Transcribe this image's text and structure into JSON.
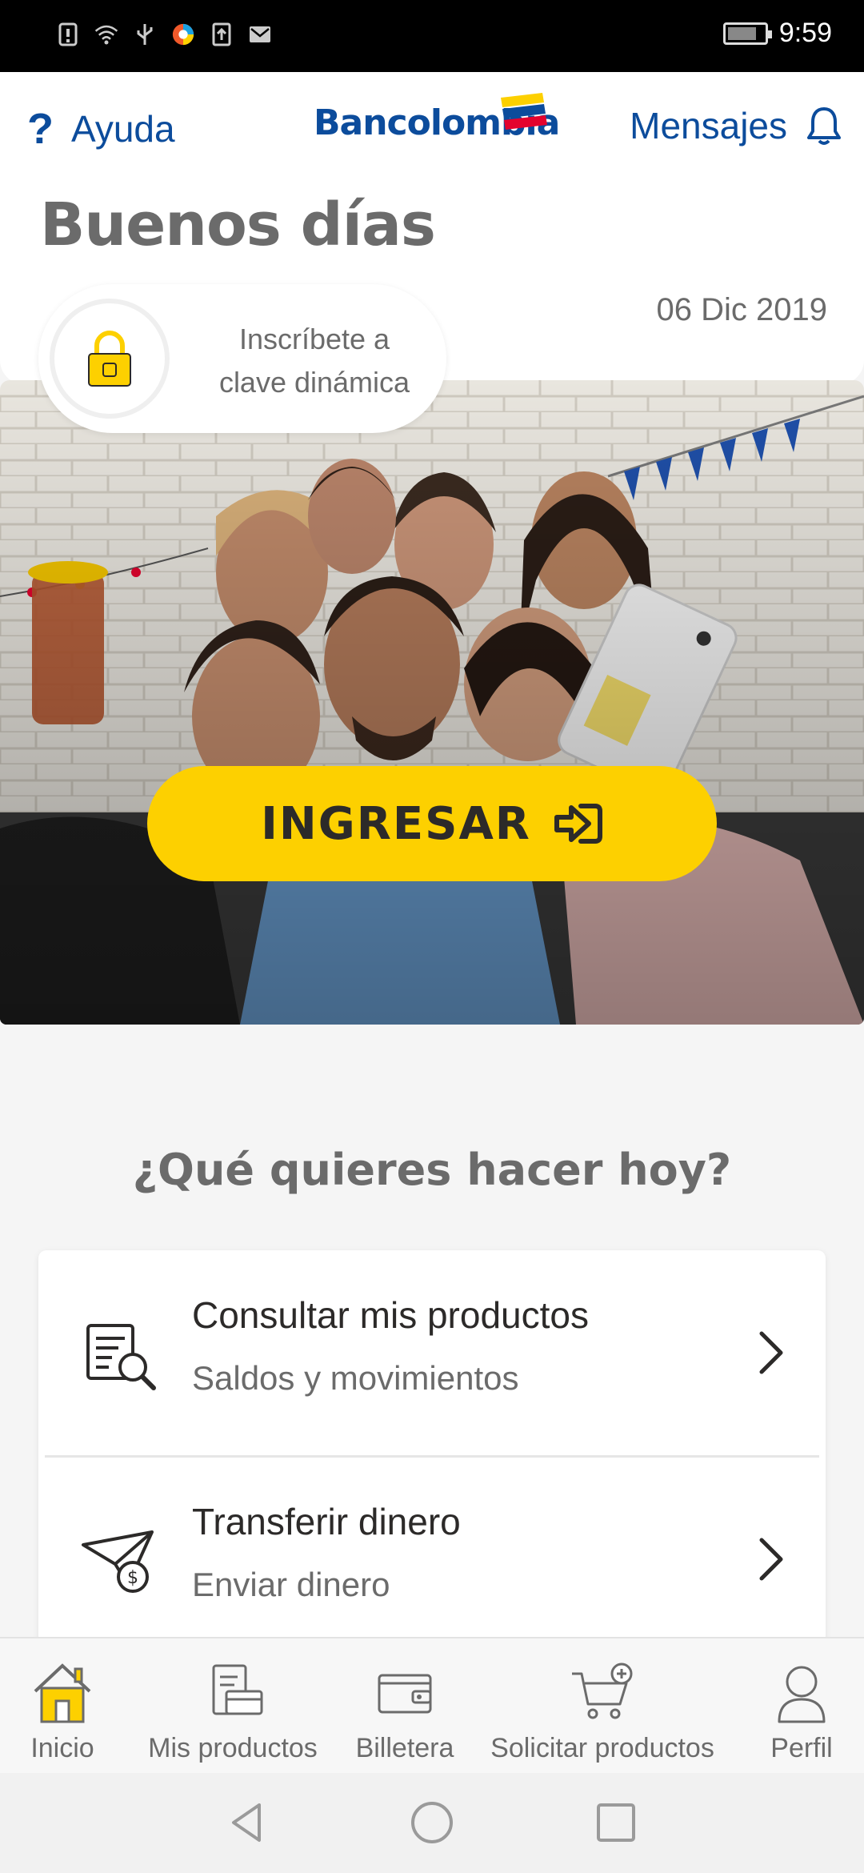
{
  "status_bar": {
    "time": "9:59",
    "icons": [
      "alert-icon",
      "wifi-icon",
      "usb-icon",
      "app-icon",
      "upload-icon",
      "mail-icon"
    ]
  },
  "header": {
    "help_label": "Ayuda",
    "brand": "Bancolombia",
    "messages_label": "Mensajes"
  },
  "greeting": {
    "title": "Buenos días",
    "date": "06 Dic 2019",
    "pill_text_line1": "Inscríbete a",
    "pill_text_line2": "clave dinámica"
  },
  "hero": {
    "cta_label": "INGRESAR"
  },
  "section": {
    "title": "¿Qué quieres hacer hoy?",
    "options": [
      {
        "title": "Consultar mis productos",
        "subtitle": "Saldos y movimientos",
        "icon": "document-search-icon"
      },
      {
        "title": "Transferir dinero",
        "subtitle": "Enviar dinero",
        "icon": "send-money-icon"
      }
    ]
  },
  "bottom_nav": {
    "items": [
      {
        "label": "Inicio",
        "icon": "home-icon",
        "active": true
      },
      {
        "label": "Mis productos",
        "icon": "products-icon"
      },
      {
        "label": "Billetera",
        "icon": "wallet-icon"
      },
      {
        "label": "Solicitar productos",
        "icon": "cart-add-icon"
      },
      {
        "label": "Perfil",
        "icon": "user-icon"
      }
    ]
  },
  "colors": {
    "brand_blue": "#0c4c9c",
    "brand_yellow": "#fdd000",
    "text_gray": "#6b6b6b"
  }
}
